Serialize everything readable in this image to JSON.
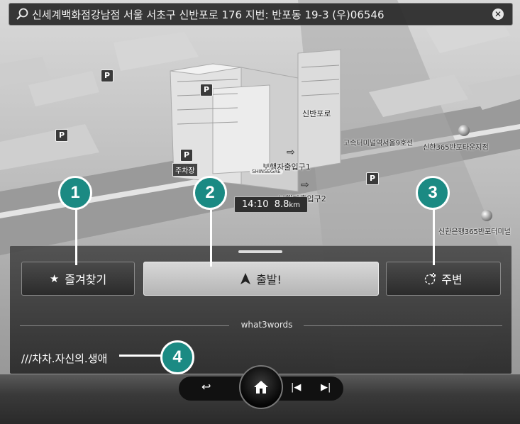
{
  "search": {
    "address": "신세계백화점강남점 서울 서초구 신반포로 176 지번: 반포동 19-3 (우)06546",
    "clear_icon": "close-circle-icon"
  },
  "map": {
    "parking_symbol": "P",
    "labels": {
      "road": "신반포로",
      "station": "고속터미널역서울9호선",
      "exit1": "보행자출입구1",
      "exit2": "보행자출입구2",
      "parking": "주차장",
      "bank1": "신한365반포타운지점",
      "bank2": "신한은행365반포터미널",
      "brand": "SHINSEGAE"
    },
    "eta_time": "14:10",
    "eta_dist": "8.8",
    "eta_unit": "km"
  },
  "panel": {
    "favorites_label": "즐겨찾기",
    "go_label": "출발!",
    "nearby_label": "주변",
    "w3w_label": "what3words",
    "w3w_address": "///차차.자신의.생애"
  },
  "controls": {
    "back_icon": "back-arrow-icon",
    "home_icon": "home-icon",
    "prev_icon": "skip-previous-icon",
    "next_icon": "skip-next-icon"
  },
  "callouts": [
    "1",
    "2",
    "3",
    "4"
  ],
  "colors": {
    "callout": "#1b8a83"
  }
}
